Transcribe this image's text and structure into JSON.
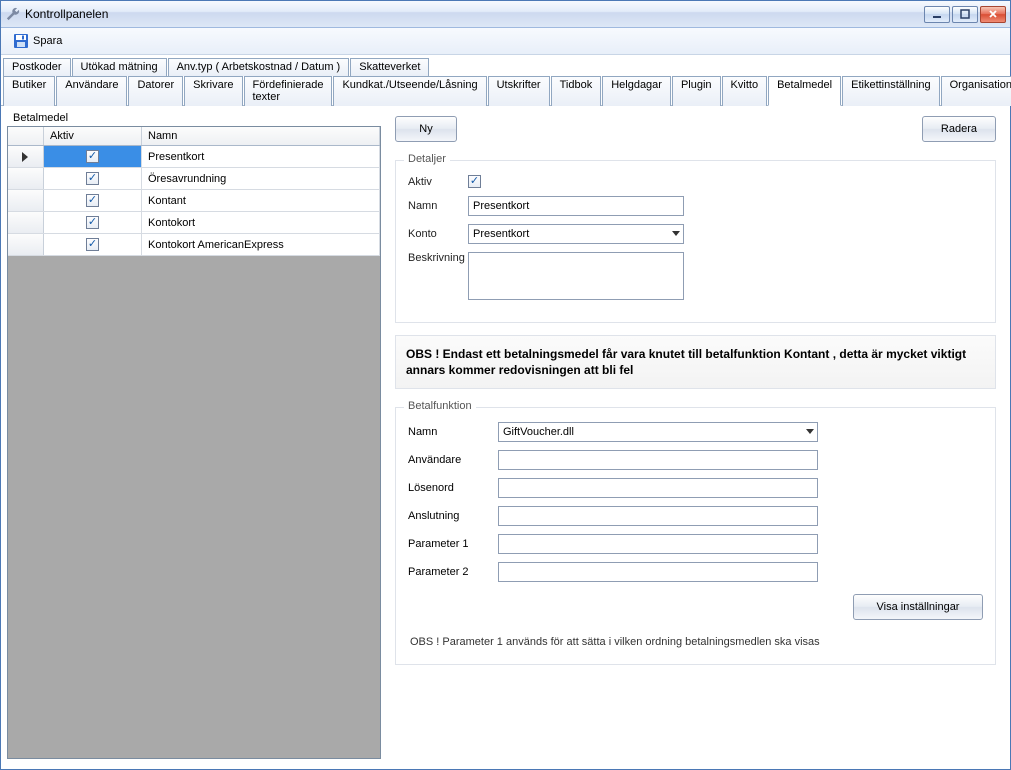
{
  "window": {
    "title": "Kontrollpanelen"
  },
  "toolbar": {
    "save": "Spara"
  },
  "tabs_row1": [
    "Postkoder",
    "Utökad mätning",
    "Anv.typ ( Arbetskostnad / Datum )",
    "Skatteverket"
  ],
  "tabs_row2": [
    "Butiker",
    "Användare",
    "Datorer",
    "Skrivare",
    "Fördefinierade texter",
    "Kundkat./Utseende/Låsning",
    "Utskrifter",
    "Tidbok",
    "Helgdagar",
    "Plugin",
    "Kvitto",
    "Betalmedel",
    "Etikettinställning",
    "Organisationsuppgifter"
  ],
  "active_tab": "Betalmedel",
  "leftgroup_title": "Betalmedel",
  "grid": {
    "headers": {
      "aktiv": "Aktiv",
      "namn": "Namn"
    },
    "rows": [
      {
        "aktiv": true,
        "namn": "Presentkort",
        "selected": true
      },
      {
        "aktiv": true,
        "namn": "Öresavrundning"
      },
      {
        "aktiv": true,
        "namn": "Kontant"
      },
      {
        "aktiv": true,
        "namn": "Kontokort"
      },
      {
        "aktiv": true,
        "namn": "Kontokort AmericanExpress"
      }
    ]
  },
  "buttons": {
    "ny": "Ny",
    "radera": "Radera",
    "visa": "Visa inställningar"
  },
  "detaljer": {
    "legend": "Detaljer",
    "labels": {
      "aktiv": "Aktiv",
      "namn": "Namn",
      "konto": "Konto",
      "beskrivning": "Beskrivning"
    },
    "aktiv": true,
    "namn": "Presentkort",
    "konto": "Presentkort",
    "beskrivning": ""
  },
  "notice": "OBS ! Endast ett betalningsmedel får vara knutet till betalfunktion Kontant , detta är mycket viktigt annars kommer redovisningen att bli fel",
  "betalfunktion": {
    "legend": "Betalfunktion",
    "labels": {
      "namn": "Namn",
      "anvandare": "Användare",
      "losenord": "Lösenord",
      "anslutning": "Anslutning",
      "param1": "Parameter 1",
      "param2": "Parameter 2"
    },
    "namn": "GiftVoucher.dll",
    "anvandare": "",
    "losenord": "",
    "anslutning": "",
    "param1": "",
    "param2": "",
    "note": "OBS ! Parameter 1 används för att sätta i vilken ordning betalningsmedlen ska visas"
  }
}
